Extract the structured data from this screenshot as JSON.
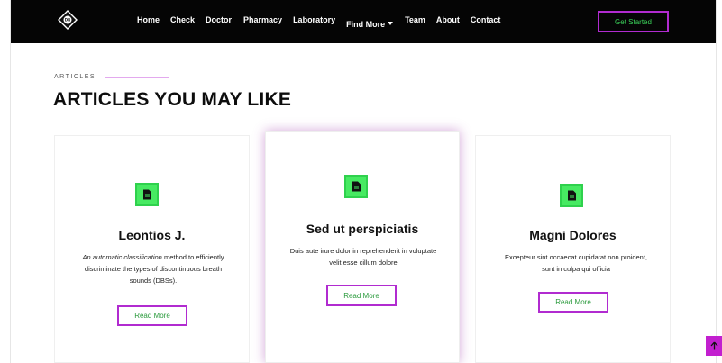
{
  "nav": {
    "logo_text": "DR",
    "items": [
      "Home",
      "Check",
      "Doctor",
      "Pharmacy",
      "Laboratory",
      "Find More",
      "Team",
      "About",
      "Contact"
    ],
    "cta_label": "Get Started"
  },
  "section": {
    "eyebrow": "ARTICLES",
    "title": "ARTICLES YOU MAY LIKE"
  },
  "cards": [
    {
      "icon": "document-icon",
      "title": "Leontios J.",
      "text_italic": "An automatic classification",
      "text_rest": " method to efficiently discriminate the types of discontinuous breath sounds (DBSs).",
      "button": "Read More"
    },
    {
      "icon": "document-icon",
      "title": "Sed ut perspiciatis",
      "text": "Duis aute irure dolor in reprehenderit in voluptate velit esse cillum dolore",
      "button": "Read More"
    },
    {
      "icon": "document-icon",
      "title": "Magni Dolores",
      "text": "Excepteur sint occaecat cupidatat non proident, sunt in culpa qui officia",
      "button": "Read More"
    }
  ],
  "scroll_top_icon": "arrow-up-icon",
  "colors": {
    "topbar": "#050505",
    "accent_magenta": "#b12bd0",
    "accent_green": "#47ea62"
  }
}
